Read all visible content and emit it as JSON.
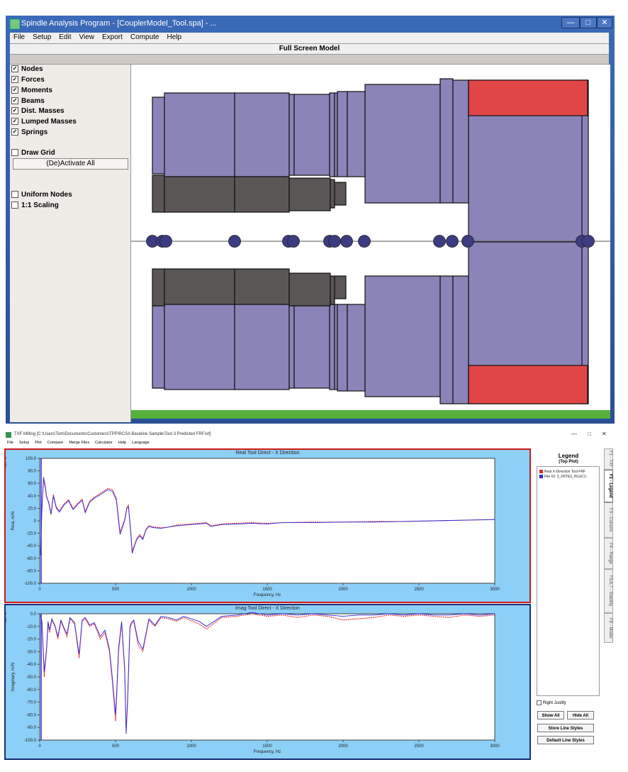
{
  "spindle": {
    "title": "Spindle Analysis Program - [CouplerModel_Tool.spa] - ...",
    "menu": [
      "File",
      "Setup",
      "Edit",
      "View",
      "Export",
      "Compute",
      "Help"
    ],
    "header": "Full Screen Model",
    "checkboxes": [
      {
        "label": "Nodes",
        "checked": true
      },
      {
        "label": "Forces",
        "checked": true
      },
      {
        "label": "Moments",
        "checked": true
      },
      {
        "label": "Beams",
        "checked": true
      },
      {
        "label": "Dist. Masses",
        "checked": true
      },
      {
        "label": "Lumped Masses",
        "checked": true
      },
      {
        "label": "Springs",
        "checked": true
      }
    ],
    "draw_grid": {
      "label": "Draw Grid",
      "checked": false
    },
    "deactivate_button": "(De)Activate All",
    "uniform_nodes": {
      "label": "Uniform Nodes",
      "checked": false
    },
    "scaling": {
      "label": "1:1 Scaling",
      "checked": false
    },
    "check_mark": "✓",
    "colors": {
      "beam": "#8b84b8",
      "dist_mass": "#5a5656",
      "spring": "#e14646",
      "node": "#3d3b82",
      "base": "#55b03c"
    }
  },
  "txf": {
    "title": "TXF Milling [C:\\Users\\Tom\\Documents\\Customers\\TPP\\RCSA Baseline Sample\\Tool 3 Predicted FRF.txf]",
    "menu": [
      "File",
      "Setup",
      "Plot",
      "Compare",
      "Merge Files",
      "Calculator",
      "Help",
      "Language"
    ],
    "window_controls": {
      "minimize": "—",
      "maximize": "□",
      "close": "✕"
    },
    "legend": {
      "title": "Legend",
      "subtitle": "(Top Plot)",
      "items": [
        {
          "label": "Real X-Direction Tool FRF",
          "color": "#e8242a"
        },
        {
          "label": "File #2: 3_FRTE3_HLGC1-",
          "color": "#2a2ad8"
        }
      ],
      "right_justify": "Right Justify",
      "buttons": {
        "show_all": "Show All",
        "hide_all": "Hide All",
        "store": "Store Line Styles",
        "default": "Default Line Styles"
      }
    },
    "tabs": [
      "F1 - TXF",
      "F2 - Legend",
      "F3 - Cursors",
      "F4 - Range",
      "F5,6,7 - Stability",
      "F8 - Model"
    ]
  },
  "chart_data": [
    {
      "type": "line",
      "title": "Real Tool Direct - X Direction",
      "xlabel": "Frequency, Hz",
      "ylabel": "Real, m/N",
      "yscale_label": "x10^-9",
      "xlim": [
        0,
        3000
      ],
      "ylim": [
        -100,
        100
      ],
      "xticks": [
        0,
        500,
        1000,
        1500,
        2000,
        2500,
        3000
      ],
      "yticks": [
        100,
        80,
        60,
        40,
        20,
        0,
        -20,
        -40,
        -60,
        -80,
        -100
      ],
      "ytick_labels": [
        "100.0",
        "80.0",
        "60.0",
        "40.0",
        "20.0",
        "0",
        "-20.0",
        "-40.0",
        "-60.0",
        "-80.0",
        "-100.0"
      ],
      "grid": false,
      "series": [
        {
          "name": "Real X-Direction Tool FRF",
          "color": "#e8242a",
          "x": [
            5,
            15,
            25,
            35,
            45,
            60,
            75,
            90,
            110,
            130,
            160,
            190,
            220,
            250,
            280,
            300,
            330,
            360,
            400,
            450,
            480,
            505,
            530,
            560,
            575,
            585,
            600,
            610,
            625,
            640,
            660,
            680,
            700,
            720,
            750,
            800,
            850,
            900,
            1000,
            1100,
            1130,
            1200,
            1300,
            1400,
            1500,
            1600,
            1800,
            2000,
            2200,
            2400,
            2600,
            2800,
            3000
          ],
          "y": [
            -50,
            20,
            65,
            55,
            38,
            30,
            12,
            42,
            22,
            16,
            27,
            34,
            20,
            28,
            35,
            15,
            32,
            38,
            44,
            52,
            50,
            37,
            -18,
            2,
            22,
            25,
            -15,
            -48,
            -38,
            -28,
            -22,
            -28,
            -14,
            -8,
            -10,
            -11,
            -10,
            -7,
            -5,
            -3,
            -8,
            -5,
            -4,
            -3,
            -4,
            -3,
            -2,
            -2,
            -1,
            -1,
            0,
            1,
            2
          ]
        },
        {
          "name": "File #2: 3_FRTE3_HLGC1-",
          "color": "#2a2ad8",
          "x": [
            5,
            15,
            25,
            35,
            45,
            60,
            75,
            90,
            110,
            130,
            160,
            190,
            220,
            250,
            280,
            300,
            330,
            360,
            400,
            450,
            480,
            505,
            530,
            560,
            575,
            585,
            600,
            610,
            625,
            640,
            660,
            680,
            700,
            720,
            750,
            800,
            850,
            900,
            1000,
            1100,
            1130,
            1200,
            1300,
            1400,
            1500,
            1600,
            1800,
            2000,
            2200,
            2400,
            2600,
            2800,
            3000
          ],
          "y": [
            -55,
            22,
            70,
            58,
            40,
            28,
            10,
            40,
            20,
            14,
            25,
            32,
            18,
            26,
            33,
            13,
            30,
            36,
            42,
            50,
            47,
            33,
            -22,
            0,
            20,
            23,
            -18,
            -52,
            -40,
            -30,
            -24,
            -30,
            -15,
            -9,
            -11,
            -12,
            -10,
            -8,
            -6,
            -4,
            -9,
            -6,
            -5,
            -4,
            -5,
            -3,
            -3,
            -2,
            -2,
            -1,
            0,
            1,
            2
          ]
        }
      ]
    },
    {
      "type": "line",
      "title": "Imag Tool Direct - X Direction",
      "xlabel": "Frequency, Hz",
      "ylabel": "Imaginary, m/N",
      "yscale_label": "x10^-9",
      "xlim": [
        0,
        3000
      ],
      "ylim": [
        -100,
        0
      ],
      "xticks": [
        0,
        500,
        1000,
        1500,
        2000,
        2500,
        3000
      ],
      "yticks": [
        0,
        -10,
        -20,
        -30,
        -40,
        -50,
        -60,
        -70,
        -80,
        -90,
        -100
      ],
      "ytick_labels": [
        "0.0",
        "-10.0",
        "-20.0",
        "-30.0",
        "-40.0",
        "-50.0",
        "-60.0",
        "-70.0",
        "-80.0",
        "-90.0",
        "-100.0"
      ],
      "grid": false,
      "series": [
        {
          "name": "Real X-Direction Tool FRF",
          "color": "#e8242a",
          "x": [
            5,
            15,
            30,
            45,
            55,
            65,
            80,
            100,
            120,
            140,
            160,
            180,
            200,
            230,
            260,
            280,
            300,
            330,
            360,
            400,
            430,
            460,
            480,
            500,
            510,
            520,
            540,
            560,
            570,
            580,
            595,
            605,
            620,
            650,
            680,
            720,
            760,
            800,
            850,
            900,
            950,
            1050,
            1100,
            1200,
            1300,
            1400,
            1500,
            1600,
            1700,
            1800,
            1900,
            2000,
            2100,
            2200,
            2300,
            2400,
            2500,
            2600,
            2700,
            2800,
            2900,
            3000
          ],
          "y": [
            -2,
            -8,
            -50,
            -30,
            -8,
            -15,
            -5,
            -10,
            -20,
            -6,
            -12,
            -18,
            -4,
            -8,
            -35,
            -6,
            -4,
            -10,
            -8,
            -20,
            -15,
            -30,
            -55,
            -85,
            -60,
            -30,
            -8,
            -45,
            -92,
            -70,
            -12,
            -8,
            -6,
            -25,
            -30,
            -5,
            -10,
            -3,
            -4,
            -6,
            -3,
            -8,
            -12,
            -3,
            -2,
            0,
            -2,
            -1,
            -3,
            -1,
            -2,
            -5,
            -4,
            -3,
            -1,
            -2,
            -1,
            -2,
            -3,
            -1,
            -2,
            -1
          ]
        },
        {
          "name": "File #2: 3_FRTE3_HLGC1-",
          "color": "#2a2ad8",
          "x": [
            5,
            15,
            30,
            45,
            55,
            65,
            80,
            100,
            120,
            140,
            160,
            180,
            200,
            230,
            260,
            280,
            300,
            330,
            360,
            400,
            430,
            460,
            480,
            500,
            510,
            520,
            540,
            560,
            570,
            580,
            595,
            605,
            620,
            650,
            680,
            720,
            760,
            800,
            850,
            900,
            950,
            1050,
            1100,
            1200,
            1300,
            1400,
            1500,
            1600,
            1700,
            1800,
            1900,
            2000,
            2100,
            2200,
            2300,
            2400,
            2500,
            2600,
            2700,
            2800,
            2900,
            3000
          ],
          "y": [
            -1,
            -6,
            -46,
            -28,
            -6,
            -13,
            -4,
            -9,
            -18,
            -5,
            -11,
            -16,
            -3,
            -7,
            -32,
            -5,
            -3,
            -9,
            -7,
            -18,
            -13,
            -28,
            -52,
            -80,
            -56,
            -27,
            -6,
            -42,
            -95,
            -66,
            -10,
            -7,
            -5,
            -22,
            -28,
            -4,
            -9,
            -2,
            -3,
            -5,
            -2,
            -6,
            -10,
            -2,
            -1,
            1,
            -1,
            0,
            -1,
            0,
            -1,
            -2,
            -1,
            -1,
            0,
            -1,
            0,
            -1,
            -1,
            0,
            -1,
            0
          ]
        }
      ]
    }
  ]
}
